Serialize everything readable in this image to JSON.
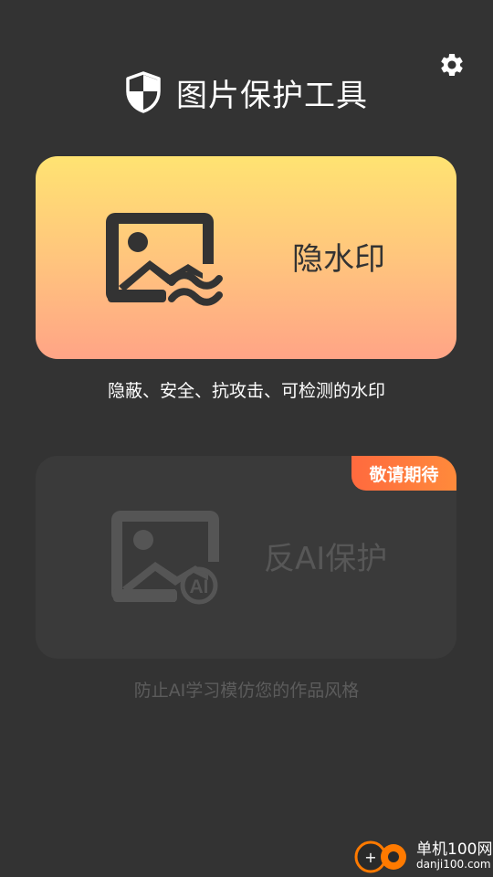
{
  "header": {
    "title": "图片保护工具",
    "logo_icon": "shield-icon",
    "settings_icon": "gear-icon"
  },
  "cards": {
    "watermark": {
      "label": "隐水印",
      "icon": "image-wave-icon",
      "caption": "隐蔽、安全、抗攻击、可检测的水印"
    },
    "anti_ai": {
      "label": "反AI保护",
      "icon": "image-ai-icon",
      "icon_text": "AI",
      "badge": "敬请期待",
      "caption": "防止AI学习模仿您的作品风格"
    }
  },
  "footer": {
    "name": "单机100网",
    "url": "danji100.com"
  },
  "colors": {
    "background": "#333333",
    "card_gradient_top": "#ffe372",
    "card_gradient_bottom": "#ffa486",
    "badge": "#ff7a3c"
  }
}
